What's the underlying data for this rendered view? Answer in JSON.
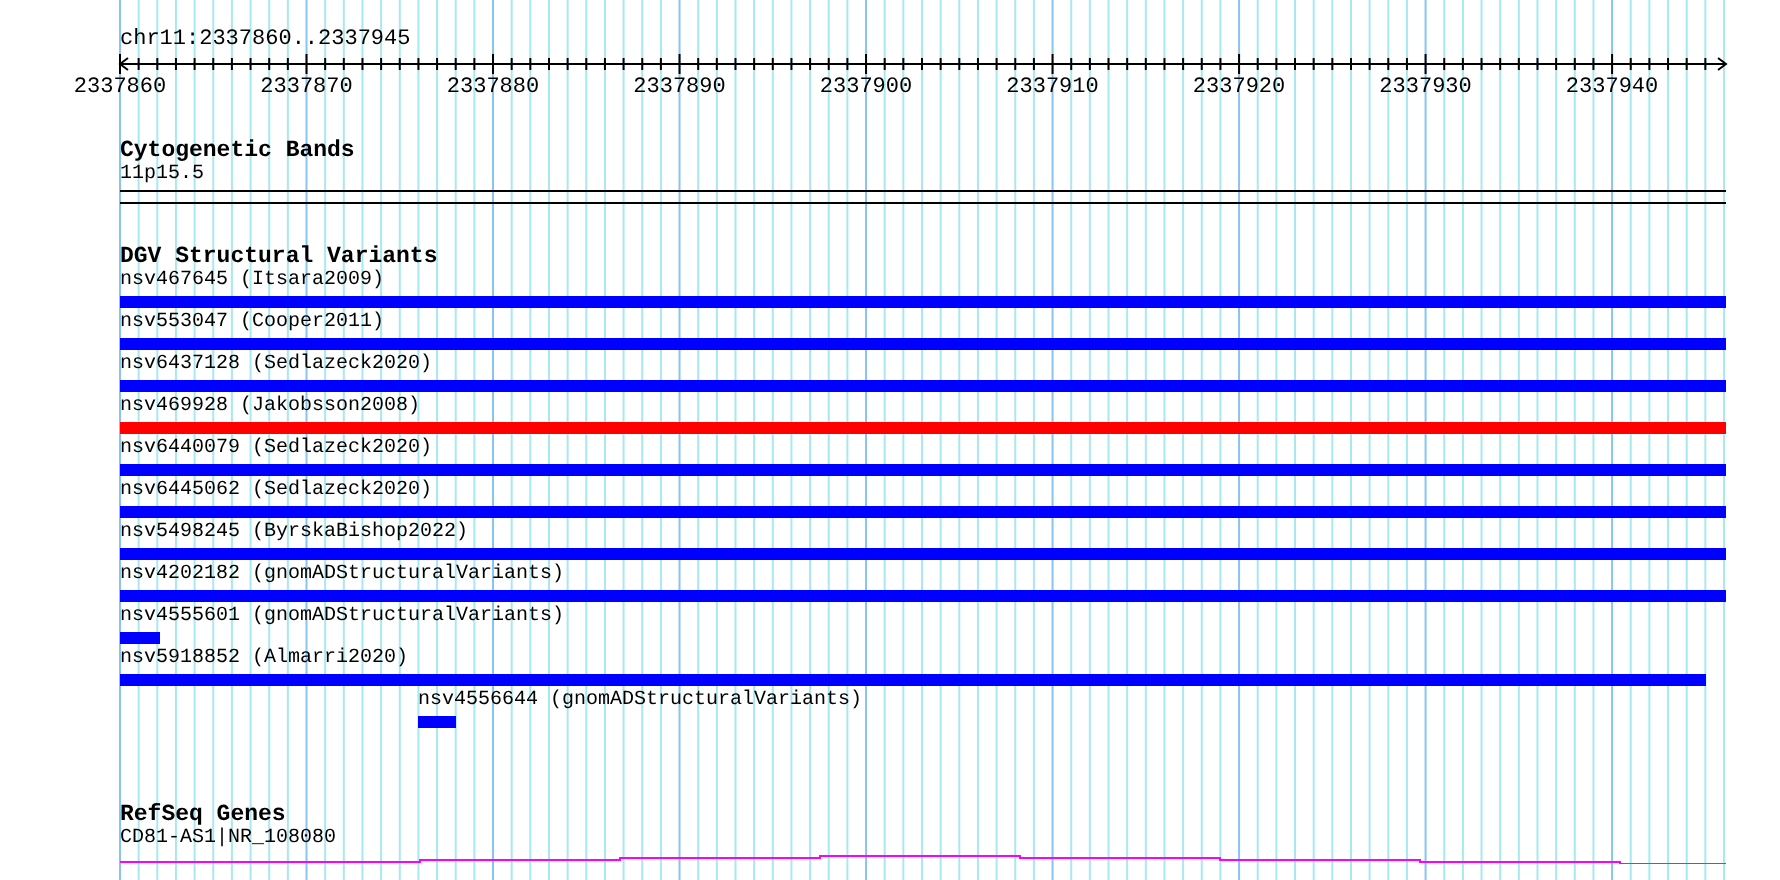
{
  "ruler": {
    "location": "chr11:2337860..2337945",
    "ticks": [
      "2337860",
      "2337870",
      "2337880",
      "2337890",
      "2337900",
      "2337910",
      "2337920",
      "2337930",
      "2337940"
    ]
  },
  "tracks": [
    {
      "kind": "bands",
      "title": "Cytogenetic Bands",
      "features": [
        {
          "label": "11p15.5"
        }
      ]
    },
    {
      "kind": "variants",
      "title": "DGV Structural Variants",
      "features": [
        {
          "label": "nsv467645 (Itsara2009)",
          "color": "#0000ff",
          "kind": "full"
        },
        {
          "label": "nsv553047 (Cooper2011)",
          "color": "#0000ff",
          "kind": "full"
        },
        {
          "label": "nsv6437128 (Sedlazeck2020)",
          "color": "#0000ff",
          "kind": "full"
        },
        {
          "label": "nsv469928 (Jakobsson2008)",
          "color": "#ff0000",
          "kind": "full"
        },
        {
          "label": "nsv6440079 (Sedlazeck2020)",
          "color": "#0000ff",
          "kind": "full"
        },
        {
          "label": "nsv6445062 (Sedlazeck2020)",
          "color": "#0000ff",
          "kind": "full"
        },
        {
          "label": "nsv5498245 (ByrskaBishop2022)",
          "color": "#0000ff",
          "kind": "full"
        },
        {
          "label": "nsv4202182 (gnomADStructuralVariants)",
          "color": "#0000ff",
          "kind": "full"
        },
        {
          "label": "nsv4555601 (gnomADStructuralVariants)",
          "color": "#0000ff",
          "kind": "stub"
        },
        {
          "label": "nsv5918852 (Almarri2020)",
          "color": "#0000ff",
          "kind": "truncated"
        },
        {
          "label": "nsv4556644 (gnomADStructuralVariants)",
          "color": "#0000ff",
          "kind": "inset"
        }
      ]
    },
    {
      "kind": "genes",
      "title": "RefSeq Genes",
      "features": [
        {
          "label": "CD81-AS1|NR_108080"
        }
      ]
    }
  ]
}
